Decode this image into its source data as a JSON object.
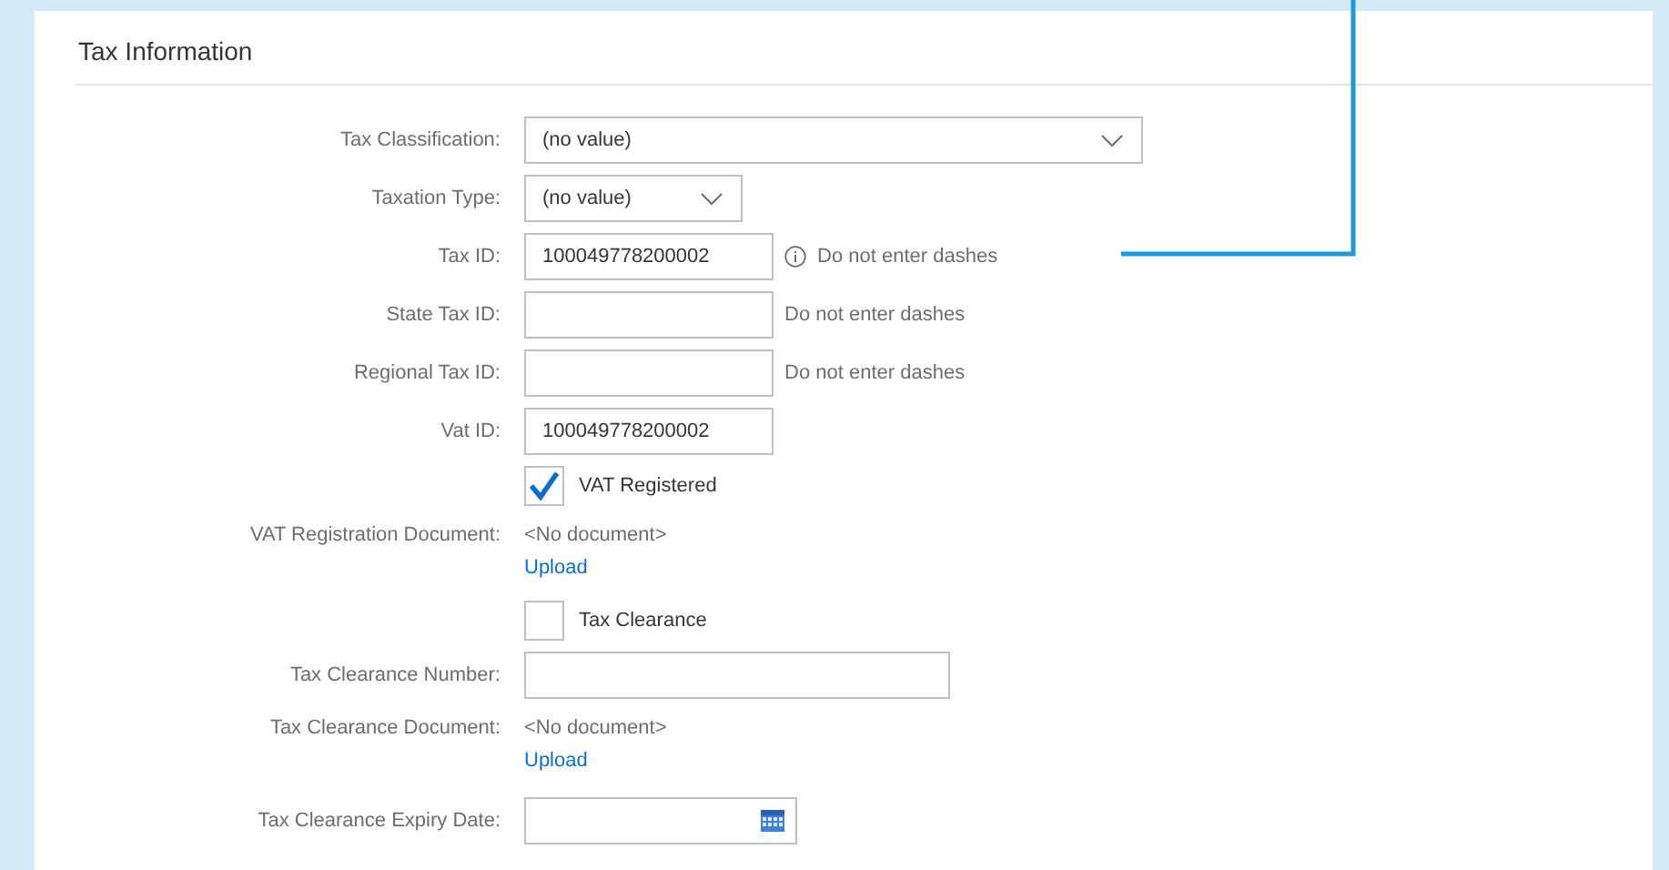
{
  "section": {
    "title": "Tax Information"
  },
  "fields": [
    {
      "kind": "select",
      "label": "Tax Classification:",
      "value": "(no value)"
    },
    {
      "kind": "select",
      "label": "Taxation Type:",
      "value": "(no value)"
    },
    {
      "kind": "input",
      "label": "Tax ID:",
      "value": "100049778200002",
      "hint": "Do not enter dashes",
      "hint_info": true
    },
    {
      "kind": "input",
      "label": "State Tax ID:",
      "hint": "Do not enter dashes",
      "hint_info": false
    },
    {
      "kind": "input",
      "label": "Regional Tax ID:",
      "hint": "Do not enter dashes",
      "hint_info": false
    },
    {
      "kind": "input",
      "label": "Vat ID:",
      "value": "100049778200002"
    },
    {
      "kind": "checkbox",
      "text": "VAT Registered",
      "checked": true
    },
    {
      "kind": "document",
      "label": "VAT Registration Document:",
      "value": "<No document>",
      "link": "Upload"
    },
    {
      "kind": "checkbox",
      "text": "Tax Clearance",
      "checked": false
    },
    {
      "kind": "input",
      "label": "Tax Clearance Number:"
    },
    {
      "kind": "document",
      "label": "Tax Clearance Document:",
      "value": "<No document>",
      "link": "Upload"
    },
    {
      "kind": "date",
      "label": "Tax Clearance Expiry Date:"
    }
  ]
}
